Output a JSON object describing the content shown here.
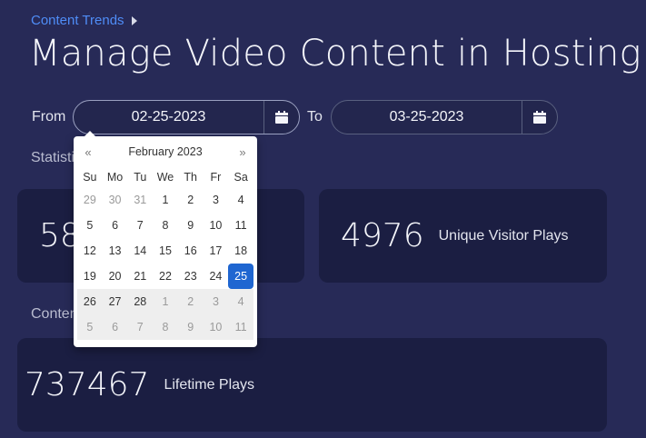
{
  "breadcrumb": {
    "label": "Content Trends"
  },
  "page": {
    "title": "Manage Video Content in Hosting"
  },
  "filters": {
    "from_label": "From",
    "from_value": "02-25-2023",
    "to_label": "To",
    "to_value": "03-25-2023"
  },
  "sections": {
    "statistics_label": "Statistic",
    "content_label": "Conten"
  },
  "stats": [
    {
      "value": "58",
      "label": ""
    },
    {
      "value": "4976",
      "label": "Unique Visitor Plays"
    },
    {
      "value": "737467",
      "label": "Lifetime Plays"
    }
  ],
  "datepicker": {
    "prev": "«",
    "next": "»",
    "month_title": "February 2023",
    "weekdays": [
      "Su",
      "Mo",
      "Tu",
      "We",
      "Th",
      "Fr",
      "Sa"
    ],
    "weeks": [
      [
        {
          "d": "29",
          "t": "old"
        },
        {
          "d": "30",
          "t": "old"
        },
        {
          "d": "31",
          "t": "old"
        },
        {
          "d": "1",
          "t": ""
        },
        {
          "d": "2",
          "t": ""
        },
        {
          "d": "3",
          "t": ""
        },
        {
          "d": "4",
          "t": ""
        }
      ],
      [
        {
          "d": "5",
          "t": ""
        },
        {
          "d": "6",
          "t": ""
        },
        {
          "d": "7",
          "t": ""
        },
        {
          "d": "8",
          "t": ""
        },
        {
          "d": "9",
          "t": ""
        },
        {
          "d": "10",
          "t": ""
        },
        {
          "d": "11",
          "t": ""
        }
      ],
      [
        {
          "d": "12",
          "t": ""
        },
        {
          "d": "13",
          "t": ""
        },
        {
          "d": "14",
          "t": ""
        },
        {
          "d": "15",
          "t": ""
        },
        {
          "d": "16",
          "t": ""
        },
        {
          "d": "17",
          "t": ""
        },
        {
          "d": "18",
          "t": ""
        }
      ],
      [
        {
          "d": "19",
          "t": ""
        },
        {
          "d": "20",
          "t": ""
        },
        {
          "d": "21",
          "t": ""
        },
        {
          "d": "22",
          "t": ""
        },
        {
          "d": "23",
          "t": ""
        },
        {
          "d": "24",
          "t": ""
        },
        {
          "d": "25",
          "t": "active"
        }
      ],
      [
        {
          "d": "26",
          "t": "range"
        },
        {
          "d": "27",
          "t": "range"
        },
        {
          "d": "28",
          "t": "range"
        },
        {
          "d": "1",
          "t": "new range"
        },
        {
          "d": "2",
          "t": "new range"
        },
        {
          "d": "3",
          "t": "new range"
        },
        {
          "d": "4",
          "t": "new range"
        }
      ],
      [
        {
          "d": "5",
          "t": "new range"
        },
        {
          "d": "6",
          "t": "new range"
        },
        {
          "d": "7",
          "t": "new range"
        },
        {
          "d": "8",
          "t": "new range"
        },
        {
          "d": "9",
          "t": "new range"
        },
        {
          "d": "10",
          "t": "new range"
        },
        {
          "d": "11",
          "t": "new range"
        }
      ]
    ]
  },
  "colors": {
    "background": "#272a57",
    "card": "#1b1e42",
    "accent": "#4f8df7",
    "selected_day": "#1f66d1"
  },
  "icons": {
    "calendar": "calendar-icon",
    "breadcrumb_caret": "caret-right-icon"
  }
}
